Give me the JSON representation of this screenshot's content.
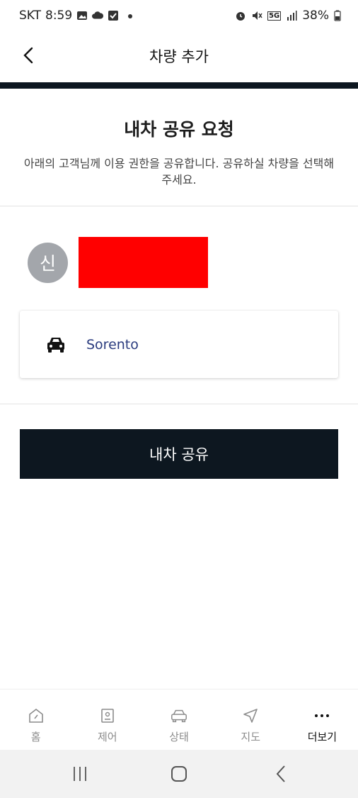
{
  "status_bar": {
    "carrier": "SKT",
    "time": "8:59",
    "network": "5G",
    "battery": "38%"
  },
  "header": {
    "title": "차량 추가"
  },
  "intro": {
    "title": "내차 공유 요청",
    "description": "아래의 고객님께 이용 권한을 공유합니다. 공유하실 차량을 선택해주세요."
  },
  "user": {
    "avatar_initial": "신"
  },
  "vehicle": {
    "name": "Sorento",
    "icon": "car-icon"
  },
  "actions": {
    "share_label": "내차 공유"
  },
  "bottom_nav": {
    "items": [
      {
        "label": "홈",
        "icon": "home-icon"
      },
      {
        "label": "제어",
        "icon": "control-icon"
      },
      {
        "label": "상태",
        "icon": "car-status-icon"
      },
      {
        "label": "지도",
        "icon": "navigation-icon"
      },
      {
        "label": "더보기",
        "icon": "more-icon"
      }
    ],
    "active_index": 4
  },
  "colors": {
    "primary_dark": "#0d1720",
    "vehicle_text": "#2a3b7e",
    "avatar_bg": "#a3a6ab",
    "redaction": "#ff0000"
  }
}
